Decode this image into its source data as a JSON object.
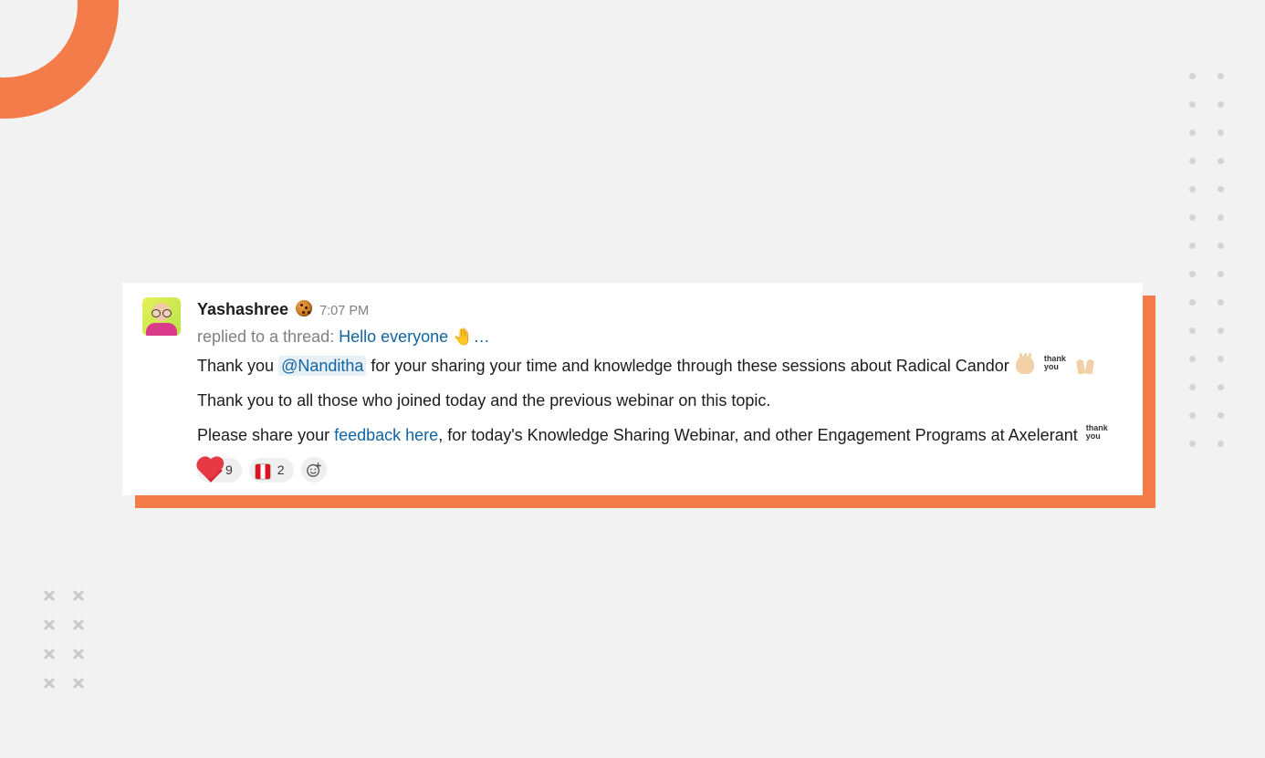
{
  "message": {
    "author": "Yashashree",
    "author_status_icon": "cookie-icon",
    "timestamp": "7:07 PM",
    "thread_prefix": "replied to a thread:",
    "thread_title": "Hello everyone",
    "thread_ellipsis": "…",
    "body": {
      "p1_part1": "Thank you ",
      "mention": "@Nanditha",
      "p1_part2": " for your sharing your time and knowledge through these sessions about Radical Candor ",
      "p2": "Thank you to all those who joined today and the previous webinar on this topic.",
      "p3_part1": "Please share your ",
      "feedback_link": "feedback here",
      "p3_part2": ", for today's Knowledge Sharing Webinar, and other Engagement Programs at Axelerant "
    },
    "reactions": [
      {
        "name": "heart",
        "count": 9
      },
      {
        "name": "flag",
        "count": 2
      }
    ]
  },
  "colors": {
    "accent": "#f47c4a",
    "link": "#1264a3"
  }
}
